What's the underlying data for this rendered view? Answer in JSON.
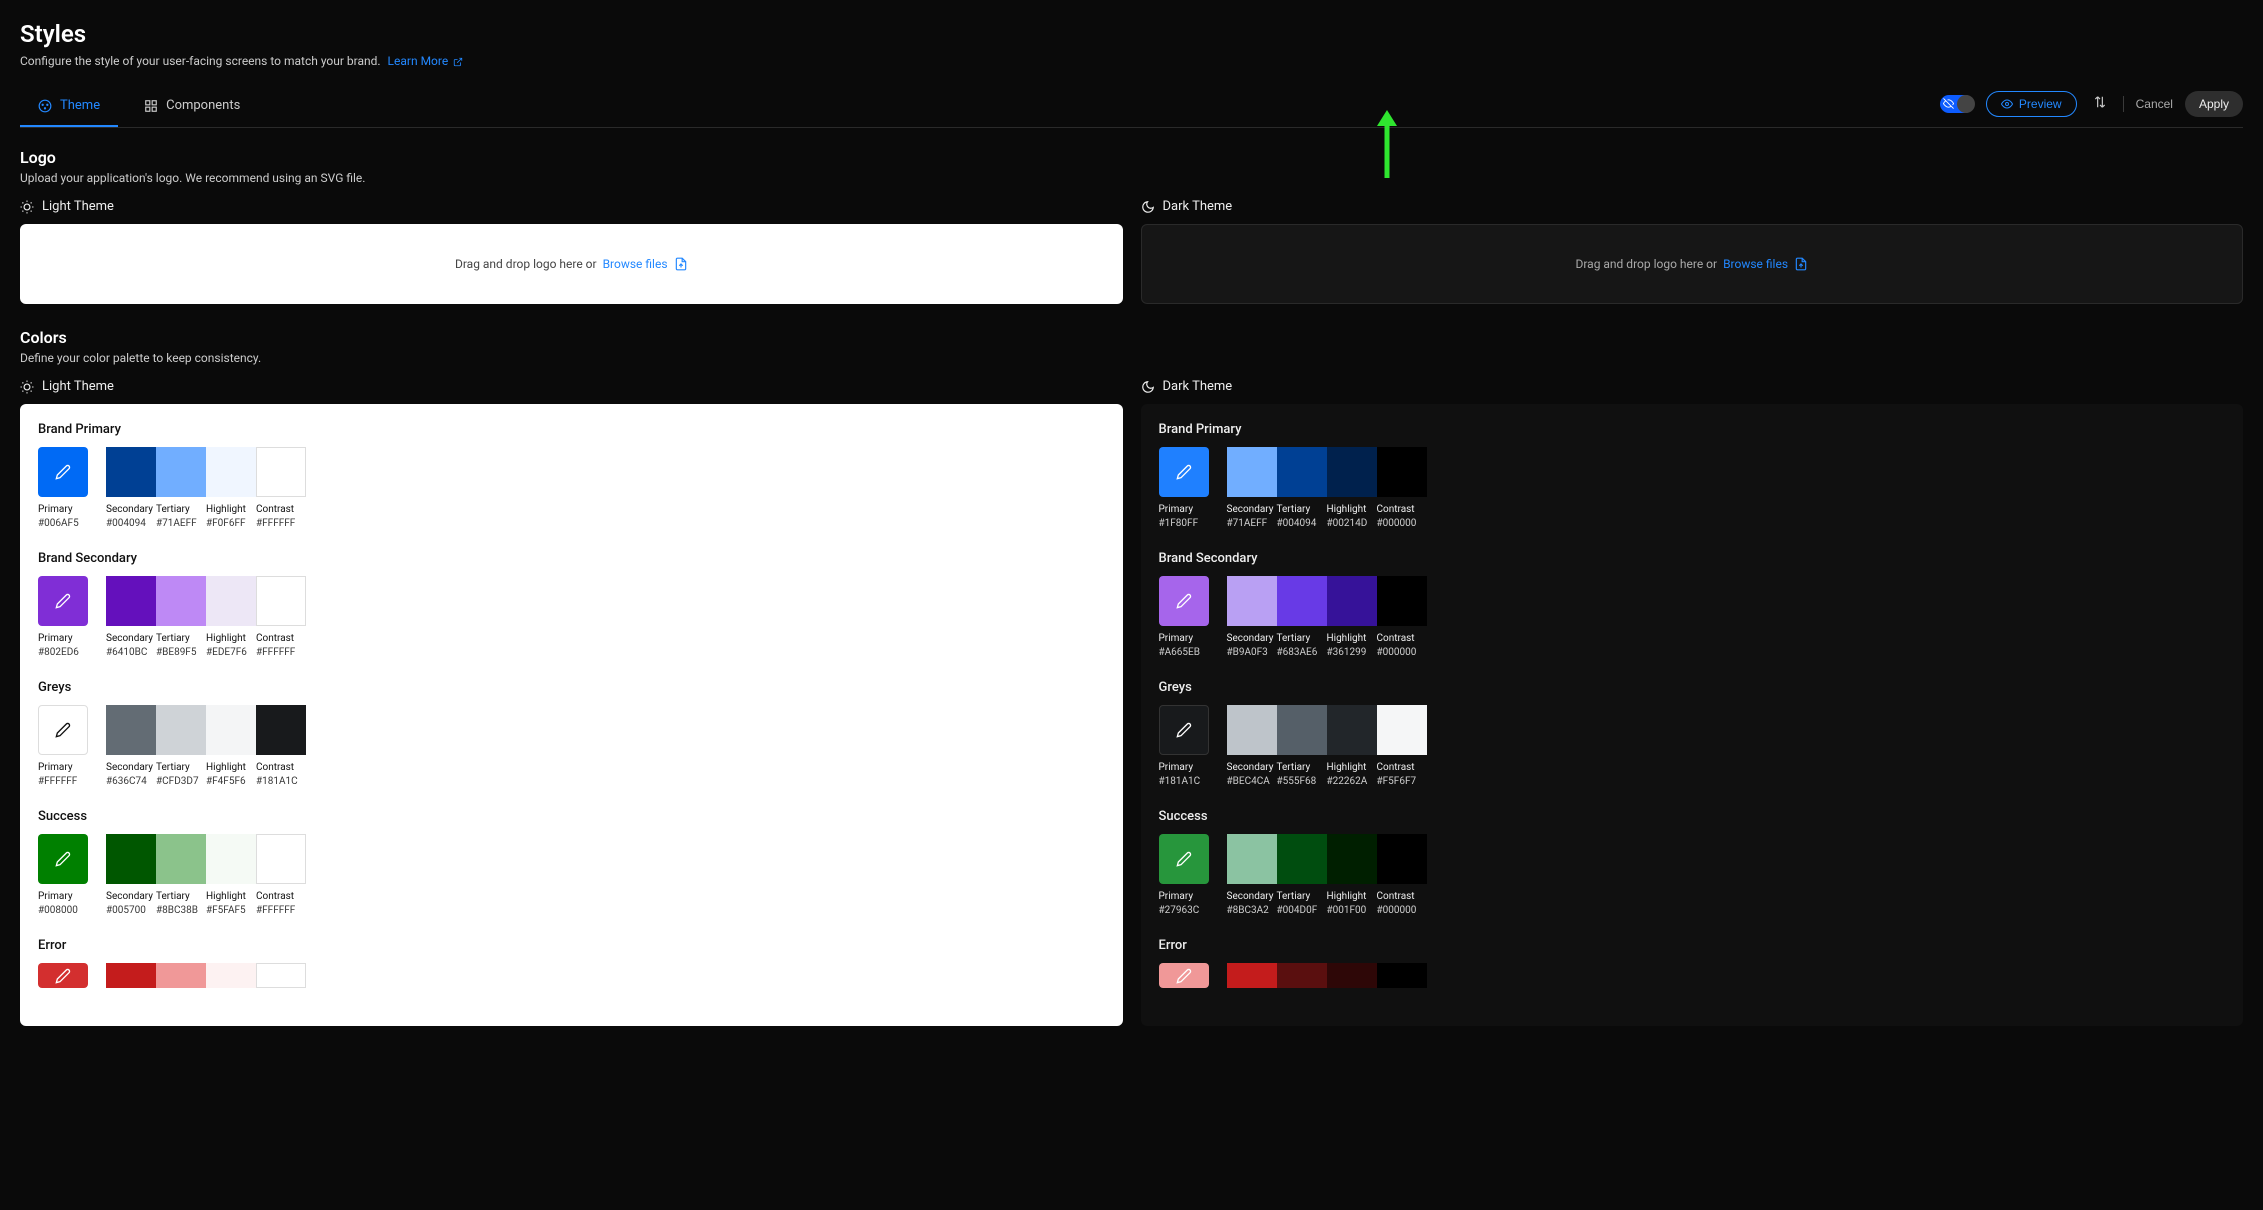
{
  "page": {
    "title": "Styles",
    "subtitle": "Configure the style of your user-facing screens to match your brand.",
    "learn_more": "Learn More"
  },
  "tabs": {
    "theme": "Theme",
    "components": "Components"
  },
  "actions": {
    "preview": "Preview",
    "cancel": "Cancel",
    "apply": "Apply"
  },
  "logo_section": {
    "title": "Logo",
    "subtitle": "Upload your application's logo. We recommend using an SVG file.",
    "light_label": "Light Theme",
    "dark_label": "Dark Theme",
    "drop_text": "Drag and drop logo here or",
    "browse": "Browse files"
  },
  "colors_section": {
    "title": "Colors",
    "subtitle": "Define your color palette to keep consistency.",
    "light_label": "Light Theme",
    "dark_label": "Dark Theme"
  },
  "swatch_labels": [
    "Primary",
    "Secondary",
    "Tertiary",
    "Highlight",
    "Contrast"
  ],
  "light_groups": [
    {
      "name": "Brand Primary",
      "colors": [
        "#006AF5",
        "#004094",
        "#71AEFF",
        "#F0F6FF",
        "#FFFFFF"
      ],
      "pencil": "#ffffff",
      "border_white": true
    },
    {
      "name": "Brand Secondary",
      "colors": [
        "#802ED6",
        "#6410BC",
        "#BE89F5",
        "#EDE7F6",
        "#FFFFFF"
      ],
      "pencil": "#ffffff",
      "border_white": true
    },
    {
      "name": "Greys",
      "colors": [
        "#FFFFFF",
        "#636C74",
        "#CFD3D7",
        "#F4F5F6",
        "#181A1C"
      ],
      "pencil": "#111111",
      "border_primary": true
    },
    {
      "name": "Success",
      "colors": [
        "#008000",
        "#005700",
        "#8BC38B",
        "#F5FAF5",
        "#FFFFFF"
      ],
      "pencil": "#ffffff",
      "border_white": true
    },
    {
      "name": "Error",
      "colors": [
        "#D32F2F",
        "#C41C1C",
        "#F09898",
        "#FDF2F2",
        "#FFFFFF"
      ],
      "pencil": "#ffffff",
      "border_white": true,
      "partial": true
    }
  ],
  "dark_groups": [
    {
      "name": "Brand Primary",
      "colors": [
        "#1F80FF",
        "#71AEFF",
        "#004094",
        "#00214D",
        "#000000"
      ],
      "pencil": "#ffffff"
    },
    {
      "name": "Brand Secondary",
      "colors": [
        "#A665EB",
        "#B9A0F3",
        "#683AE6",
        "#361299",
        "#000000"
      ],
      "pencil": "#ffffff"
    },
    {
      "name": "Greys",
      "colors": [
        "#181A1C",
        "#BEC4CA",
        "#555F68",
        "#22262A",
        "#F5F6F7"
      ],
      "pencil": "#ffffff",
      "border_primary": true
    },
    {
      "name": "Success",
      "colors": [
        "#27963C",
        "#8BC3A2",
        "#004D0F",
        "#001F00",
        "#000000"
      ],
      "pencil": "#ffffff"
    },
    {
      "name": "Error",
      "colors": [
        "#F09898",
        "#C41C1C",
        "#5A0F0F",
        "#2E0707",
        "#000000"
      ],
      "pencil": "#ffffff",
      "partial": true
    }
  ]
}
